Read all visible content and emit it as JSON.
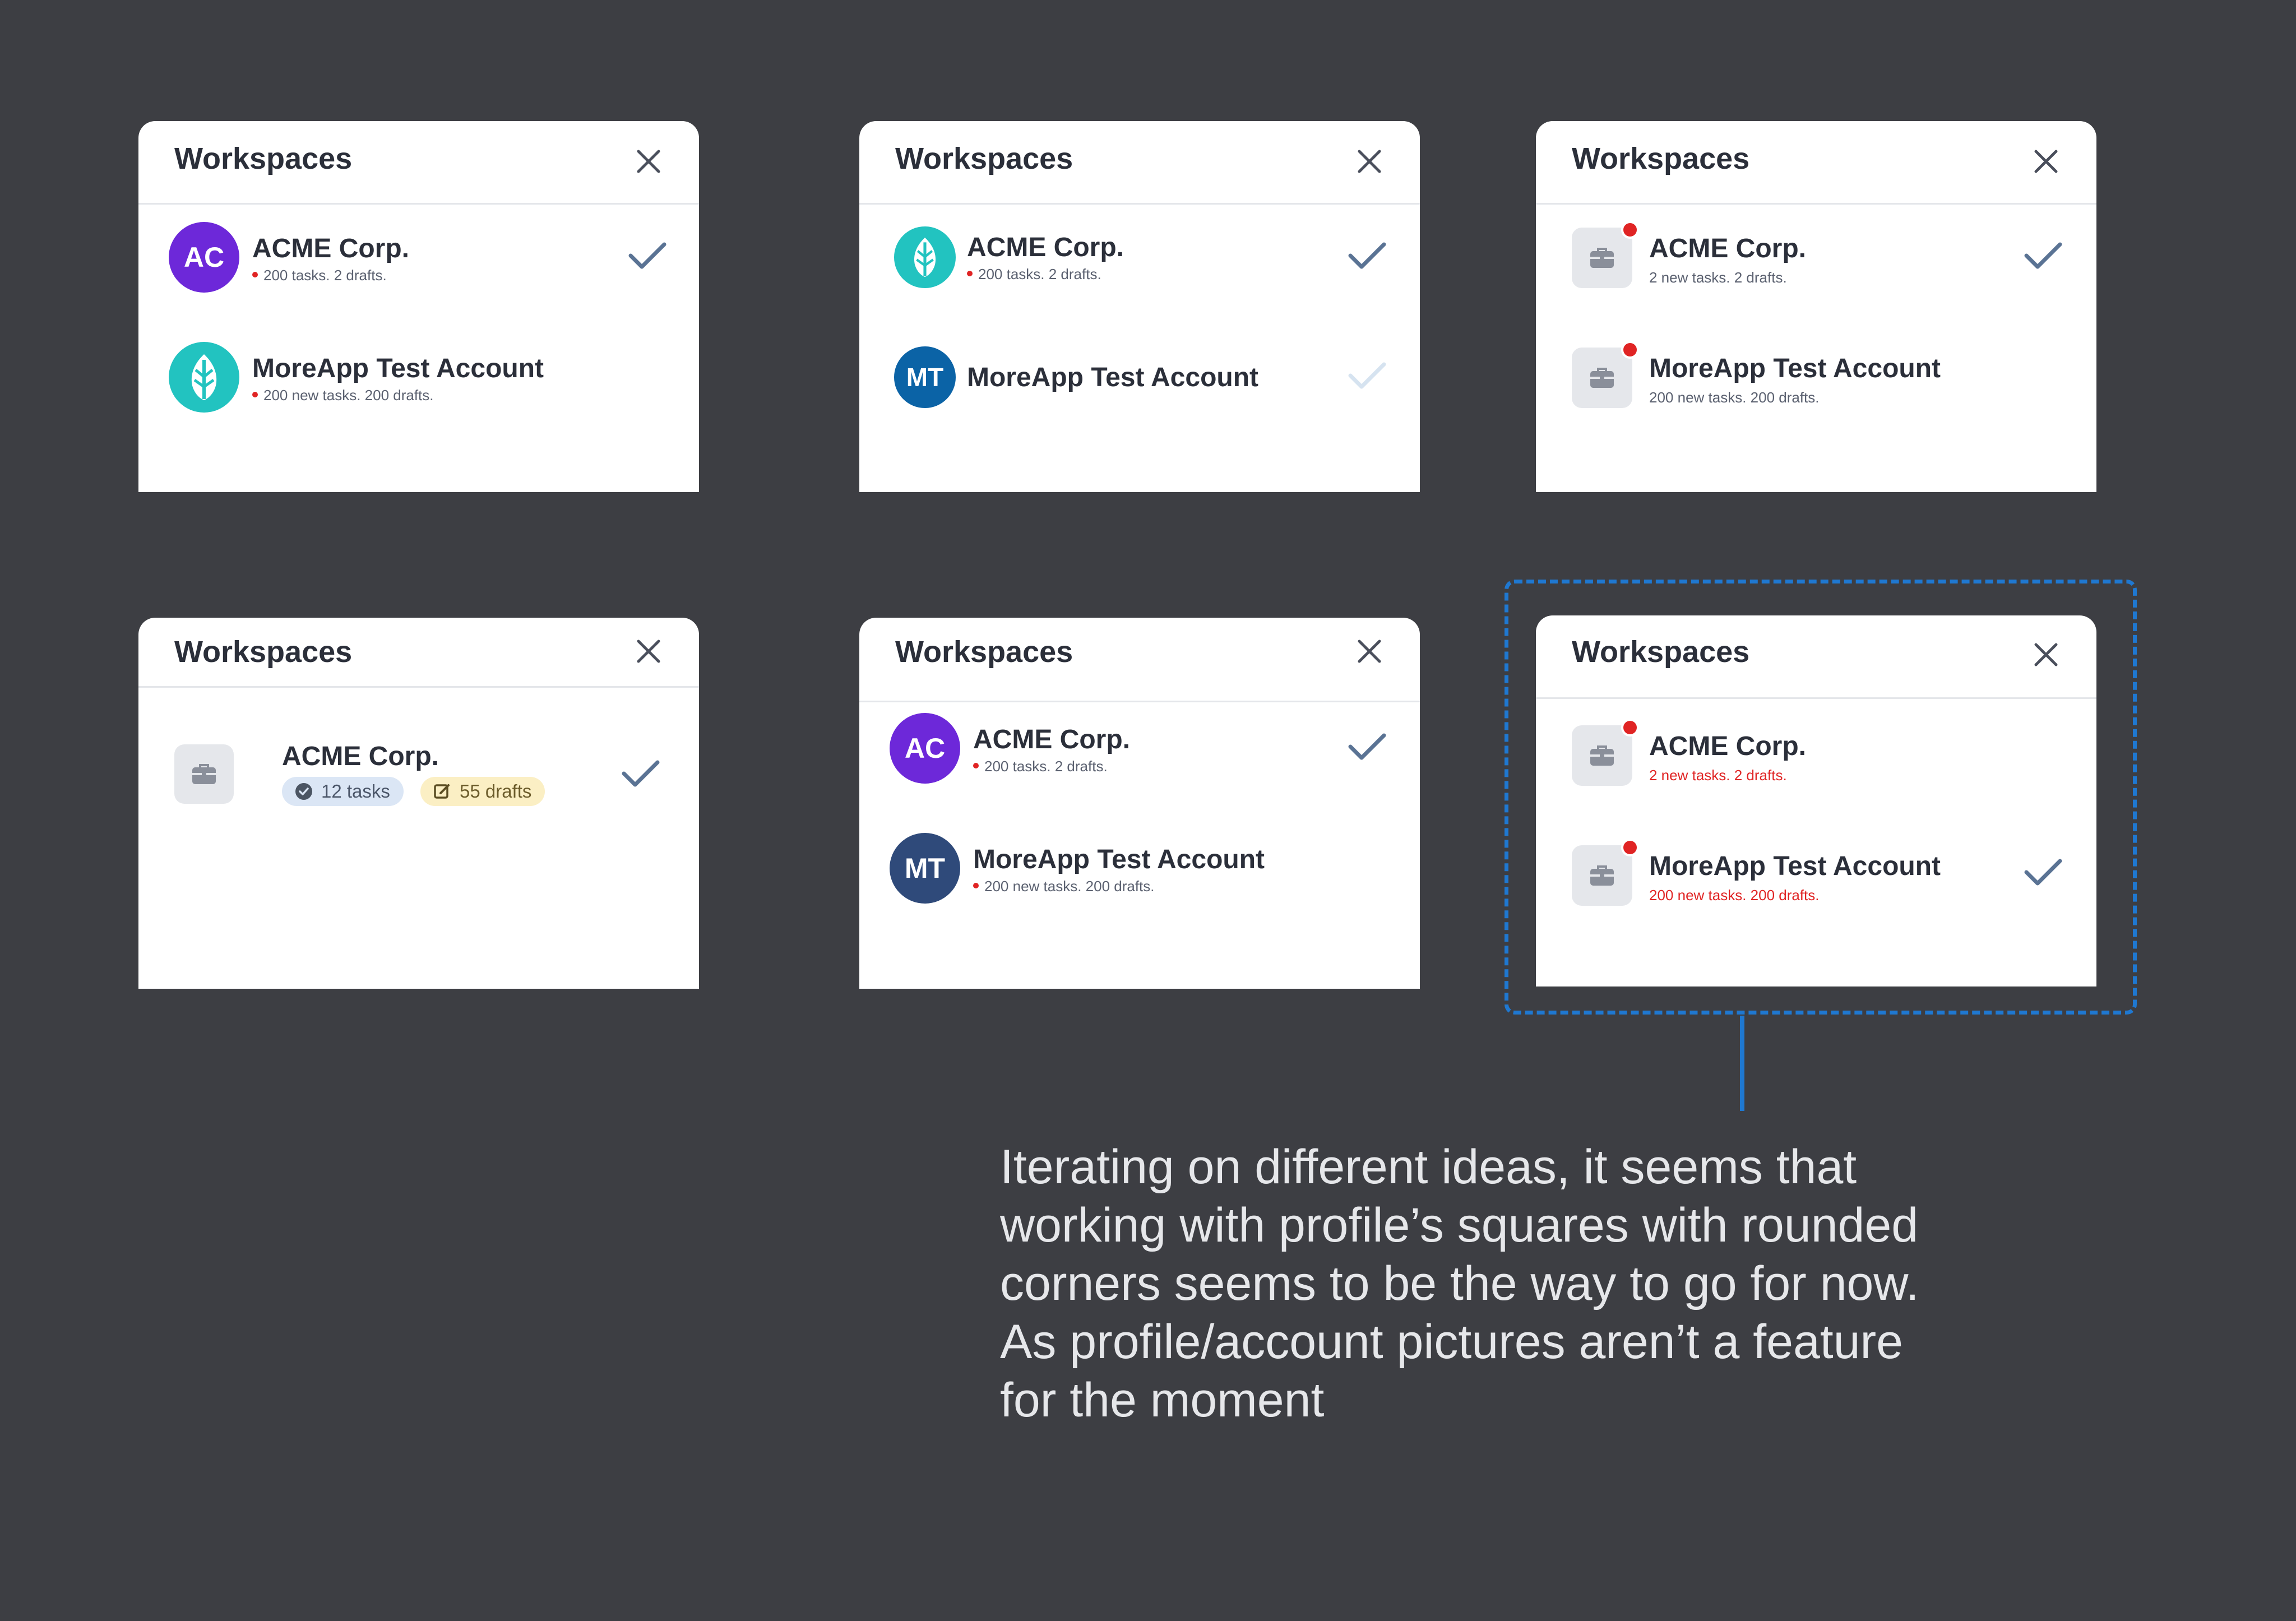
{
  "panel_title": "Workspaces",
  "cards": [
    {
      "rows": [
        {
          "name": "ACME Corp.",
          "sub": "200 tasks. 2 drafts.",
          "avatar_text": "AC"
        },
        {
          "name": "MoreApp Test Account",
          "sub": "200 new tasks. 200 drafts."
        }
      ]
    },
    {
      "rows": [
        {
          "name": "ACME Corp.",
          "sub": "200 tasks. 2 drafts."
        },
        {
          "name": "MoreApp Test Account",
          "avatar_text": "MT"
        }
      ]
    },
    {
      "rows": [
        {
          "name": "ACME Corp.",
          "sub": "2 new tasks. 2 drafts."
        },
        {
          "name": "MoreApp Test Account",
          "sub": "200 new tasks. 200 drafts."
        }
      ]
    },
    {
      "rows": [
        {
          "name": "ACME Corp.",
          "tasks_pill": "12 tasks",
          "drafts_pill": "55 drafts"
        }
      ]
    },
    {
      "rows": [
        {
          "name": "ACME Corp.",
          "sub": "200 tasks. 2 drafts.",
          "avatar_text": "AC"
        },
        {
          "name": "MoreApp Test Account",
          "sub": "200 new tasks. 200 drafts.",
          "avatar_text": "MT"
        }
      ]
    },
    {
      "rows": [
        {
          "name": "ACME Corp.",
          "sub": "2 new tasks. 2 drafts."
        },
        {
          "name": "MoreApp Test Account",
          "sub": "200 new tasks. 200 drafts."
        }
      ]
    }
  ],
  "annotation": "Iterating on different ideas, it seems that working with profile’s squares with rounded corners seems to be the way to go for now. As profile/account pictures aren’t a feature for the moment",
  "icons": {
    "close": "close-icon",
    "check": "checkmark-icon",
    "leaf": "leaf-logo-icon",
    "briefcase": "briefcase-icon",
    "tasks": "check-circle-icon",
    "drafts": "edit-icon"
  },
  "colors": {
    "background": "#3d3e43",
    "purple_avatar": "#6d28d9",
    "teal_avatar": "#22c3c0",
    "blue_avatar": "#0b63a6",
    "navy_avatar": "#2f4a7a",
    "check": "#5a7394",
    "check_faded": "#d6e3f0",
    "notification_red": "#e02424",
    "highlight_blue": "#1f78d1",
    "tasks_pill_bg": "#dbe6f5",
    "drafts_pill_bg": "#fbefc4"
  }
}
